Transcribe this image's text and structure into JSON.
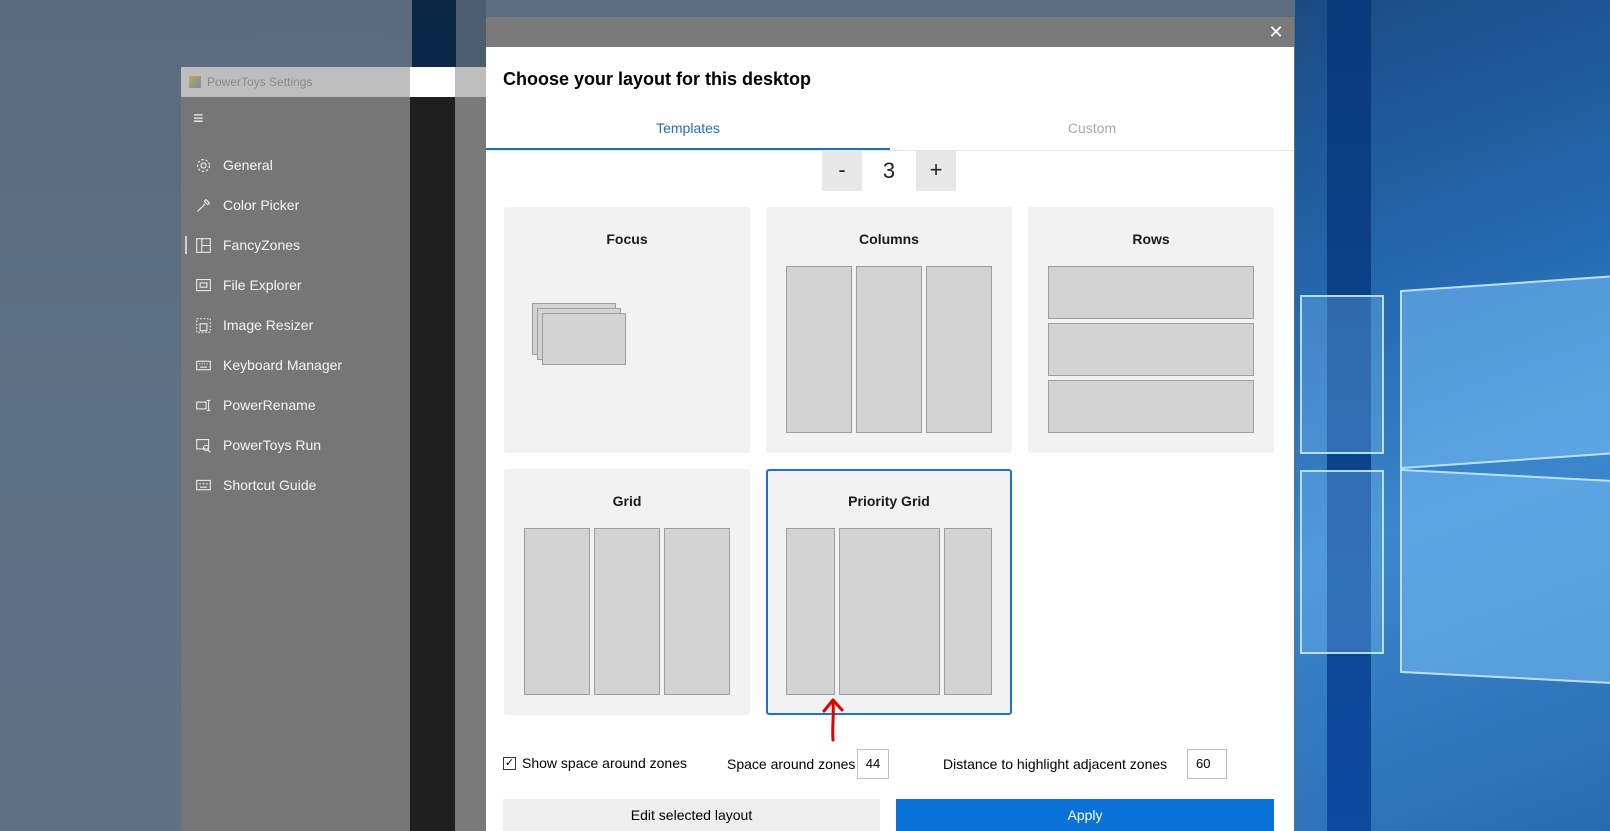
{
  "powertoys": {
    "window_title": "PowerToys Settings",
    "hamburger_glyph": "≡",
    "nav_items": [
      {
        "label": "General",
        "icon": "gear-icon"
      },
      {
        "label": "Color Picker",
        "icon": "eyedropper-icon"
      },
      {
        "label": "FancyZones",
        "icon": "grid-icon",
        "selected": true
      },
      {
        "label": "File Explorer",
        "icon": "file-explorer-icon"
      },
      {
        "label": "Image Resizer",
        "icon": "image-resize-icon"
      },
      {
        "label": "Keyboard Manager",
        "icon": "keyboard-icon"
      },
      {
        "label": "PowerRename",
        "icon": "rename-icon"
      },
      {
        "label": "PowerToys Run",
        "icon": "run-icon"
      },
      {
        "label": "Shortcut Guide",
        "icon": "shortcut-guide-icon"
      }
    ]
  },
  "dialog": {
    "close_glyph": "✕",
    "heading": "Choose your layout for this desktop",
    "tabs": {
      "templates": "Templates",
      "custom": "Custom"
    },
    "stepper": {
      "minus": "-",
      "value": "3",
      "plus": "+"
    },
    "layouts": [
      {
        "title": "Focus"
      },
      {
        "title": "Columns"
      },
      {
        "title": "Rows"
      },
      {
        "title": "Grid"
      },
      {
        "title": "Priority Grid",
        "selected": true
      }
    ],
    "options": {
      "checkbox_glyph": "✓",
      "show_space_label": "Show space around zones",
      "show_space_checked": true,
      "space_label": "Space around zones",
      "space_value": "44",
      "distance_label": "Distance to highlight adjacent zones",
      "distance_value": "60"
    },
    "buttons": {
      "edit": "Edit selected layout",
      "apply": "Apply"
    }
  },
  "colors": {
    "accent": "#0a72d6",
    "selected_border": "#1e73d2",
    "annotation_arrow": "#e00000"
  }
}
